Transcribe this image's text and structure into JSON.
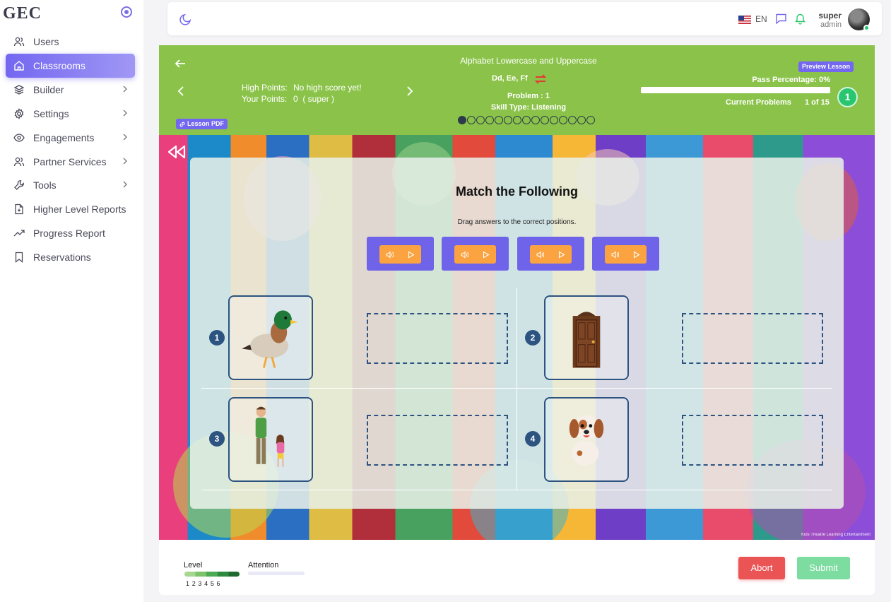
{
  "sidebar": {
    "logo": "GEC",
    "items": [
      {
        "label": "Users",
        "icon": "users-icon",
        "has_chevron": false
      },
      {
        "label": "Classrooms",
        "icon": "home-icon",
        "has_chevron": false,
        "active": true
      },
      {
        "label": "Builder",
        "icon": "layers-icon",
        "has_chevron": true
      },
      {
        "label": "Settings",
        "icon": "gear-icon",
        "has_chevron": true
      },
      {
        "label": "Engagements",
        "icon": "eye-icon",
        "has_chevron": true
      },
      {
        "label": "Partner Services",
        "icon": "users-icon",
        "has_chevron": true
      },
      {
        "label": "Tools",
        "icon": "wrench-icon",
        "has_chevron": true
      },
      {
        "label": "Higher Level Reports",
        "icon": "file-plus-icon",
        "has_chevron": false
      },
      {
        "label": "Progress Report",
        "icon": "trending-up-icon",
        "has_chevron": false
      },
      {
        "label": "Reservations",
        "icon": "bookmark-icon",
        "has_chevron": false
      }
    ]
  },
  "topbar": {
    "language": "EN",
    "user": {
      "name": "super",
      "role": "admin"
    }
  },
  "lesson": {
    "title": "Alphabet Lowercase and Uppercase",
    "letters": "Dd, Ee, Ff",
    "problem": "Problem : 1",
    "skill_type": "Skill Type: Listening",
    "high_points_label": "High Points:",
    "high_points_value": "No high score yet!",
    "your_points_label": "Your Points:",
    "your_points_value": "0  ( super )",
    "lesson_pdf": "Lesson PDF",
    "preview_lesson": "Preview Lesson",
    "pass_percentage": "Pass Percentage: 0%",
    "pass_fraction": 0,
    "current_problems_label": "Current Problems",
    "current_problems_value": "1 of 15",
    "current_badge": "1",
    "total_problems": 15,
    "current_index": 1
  },
  "activity": {
    "title": "Match the Following",
    "instruction": "Drag answers to the correct positions.",
    "audio_options": 4,
    "items": [
      {
        "number": "1",
        "picture": "duck"
      },
      {
        "number": "2",
        "picture": "door"
      },
      {
        "number": "3",
        "picture": "dad"
      },
      {
        "number": "4",
        "picture": "dog"
      }
    ],
    "watermark": "Kids Theatre Learning Entertainment"
  },
  "footer": {
    "level_label": "Level",
    "level_numbers": "123456",
    "attention_label": "Attention",
    "abort": "Abort",
    "submit": "Submit"
  },
  "colors": {
    "accent": "#7367f0",
    "lesson_header": "#8bc34a",
    "success": "#28c76f",
    "danger": "#ea5455",
    "audio_card": "#6f63ea",
    "audio_button": "#fba340"
  }
}
